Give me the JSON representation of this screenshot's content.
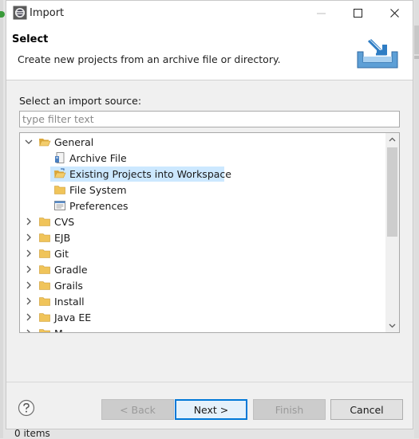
{
  "background": {
    "status_text": "0 items"
  },
  "window": {
    "title": "Import"
  },
  "header": {
    "title": "Select",
    "description": "Create new projects from an archive file or directory."
  },
  "source": {
    "label": "Select an import source:",
    "filter_placeholder": "type filter text",
    "filter_value": ""
  },
  "tree": [
    {
      "label": "General",
      "expanded": true,
      "level": 0,
      "icon": "folder-open-icon"
    },
    {
      "label": "Archive File",
      "level": 1,
      "icon": "archive-file-icon"
    },
    {
      "label": "Existing Projects into Workspace",
      "level": 1,
      "icon": "existing-projects-icon",
      "selected": true
    },
    {
      "label": "File System",
      "level": 1,
      "icon": "folder-icon"
    },
    {
      "label": "Preferences",
      "level": 1,
      "icon": "preferences-icon"
    },
    {
      "label": "CVS",
      "level": 0,
      "icon": "folder-icon"
    },
    {
      "label": "EJB",
      "level": 0,
      "icon": "folder-icon"
    },
    {
      "label": "Git",
      "level": 0,
      "icon": "folder-icon"
    },
    {
      "label": "Gradle",
      "level": 0,
      "icon": "folder-icon"
    },
    {
      "label": "Grails",
      "level": 0,
      "icon": "folder-icon"
    },
    {
      "label": "Install",
      "level": 0,
      "icon": "folder-icon"
    },
    {
      "label": "Java EE",
      "level": 0,
      "icon": "folder-icon"
    },
    {
      "label": "M",
      "level": 0,
      "icon": "folder-icon"
    }
  ],
  "buttons": {
    "back": "< Back",
    "next": "Next >",
    "finish": "Finish",
    "cancel": "Cancel"
  },
  "colors": {
    "selection": "#cce8ff",
    "default_button_border": "#0078d7",
    "folder": "#e8b84a"
  }
}
